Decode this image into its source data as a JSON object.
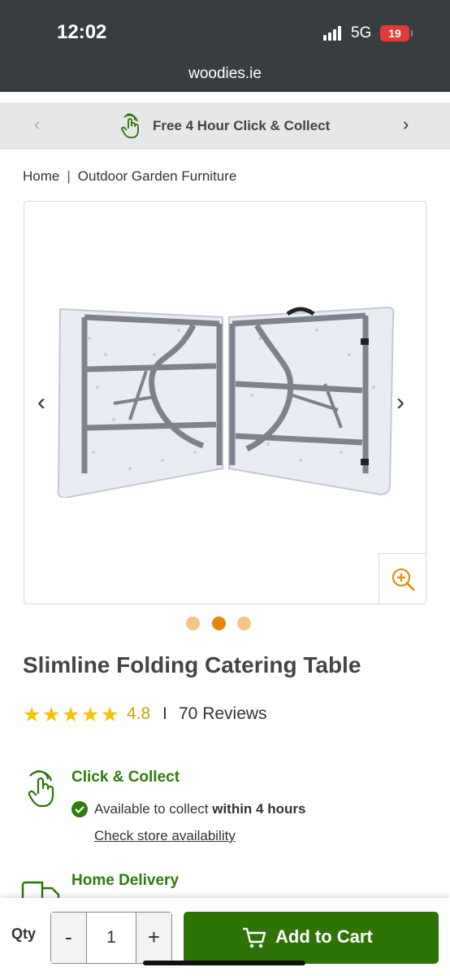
{
  "status_bar": {
    "time": "12:02",
    "network": "5G",
    "battery": "19"
  },
  "browser": {
    "url": "woodies.ie"
  },
  "promo": {
    "text": "Free 4 Hour Click & Collect",
    "prev": "‹",
    "next": "›"
  },
  "breadcrumb": {
    "items": [
      "Home",
      "Outdoor Garden Furniture"
    ],
    "separator": "|"
  },
  "gallery": {
    "prev": "‹",
    "next": "›",
    "slide_count": 3,
    "active_slide": 2
  },
  "product": {
    "title": "Slimline Folding Catering Table",
    "rating_value": "4.8",
    "rating_separator": "I",
    "reviews": "70 Reviews",
    "stars": 5
  },
  "click_collect": {
    "title": "Click & Collect",
    "availability_prefix": "Available to collect ",
    "availability_bold": "within 4 hours",
    "link": "Check store availability"
  },
  "home_delivery": {
    "title": "Home Delivery"
  },
  "cart_bar": {
    "qty_label": "Qty",
    "minus": "-",
    "quantity": "1",
    "plus": "+",
    "add_to_cart": "Add to Cart"
  },
  "colors": {
    "brand_green": "#2e7306",
    "accent_orange": "#e8860a",
    "star_yellow": "#f5c400"
  }
}
